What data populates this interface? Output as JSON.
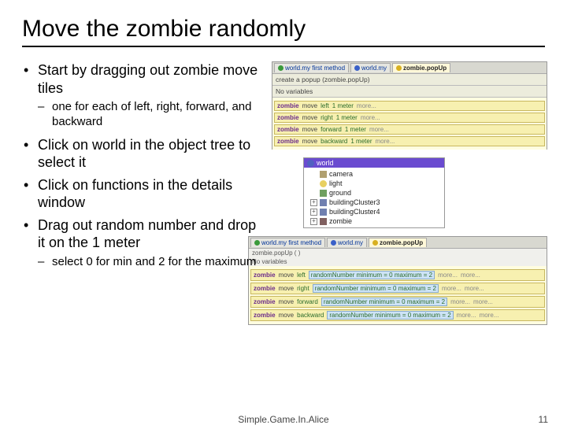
{
  "title": "Move the zombie randomly",
  "bullets": {
    "b1": "Start by dragging out zombie move tiles",
    "b1a": "one for each of left, right, forward, and backward",
    "b2": "Click on world in the object tree to select it",
    "b3": "Click on functions in the details window",
    "b4": "Drag out random number and drop it on the 1 meter",
    "b4a": "select 0 for min and 2 for the maximum"
  },
  "footer": {
    "center": "Simple.Game.In.Alice",
    "page": "11"
  },
  "panel1": {
    "tabs": [
      "world.my first method",
      "world.my",
      "zombie.popUp"
    ],
    "header": "create a popup (zombie.popUp)",
    "novars": "No variables",
    "rows": [
      [
        "zombie",
        "move",
        "left",
        "1 meter",
        "more..."
      ],
      [
        "zombie",
        "move",
        "right",
        "1 meter",
        "more..."
      ],
      [
        "zombie",
        "move",
        "forward",
        "1 meter",
        "more..."
      ],
      [
        "zombie",
        "move",
        "backward",
        "1 meter",
        "more..."
      ]
    ]
  },
  "tree": {
    "root": "world",
    "items": [
      "camera",
      "light",
      "ground",
      "buildingCluster3",
      "buildingCluster4",
      "zombie"
    ]
  },
  "panel3": {
    "tabs": [
      "world.my first method",
      "world.my",
      "zombie.popUp"
    ],
    "section": "No variables",
    "rows": [
      [
        "zombie",
        "move",
        "left",
        "randomNumber minimum = 0  maximum = 2",
        "more...",
        "more..."
      ],
      [
        "zombie",
        "move",
        "right",
        "randomNumber minimum = 0  maximum = 2",
        "more...",
        "more..."
      ],
      [
        "zombie",
        "move",
        "forward",
        "randomNumber minimum = 0  maximum = 2",
        "more...",
        "more..."
      ],
      [
        "zombie",
        "move",
        "backward",
        "randomNumber minimum = 0  maximum = 2",
        "more...",
        "more..."
      ]
    ]
  }
}
